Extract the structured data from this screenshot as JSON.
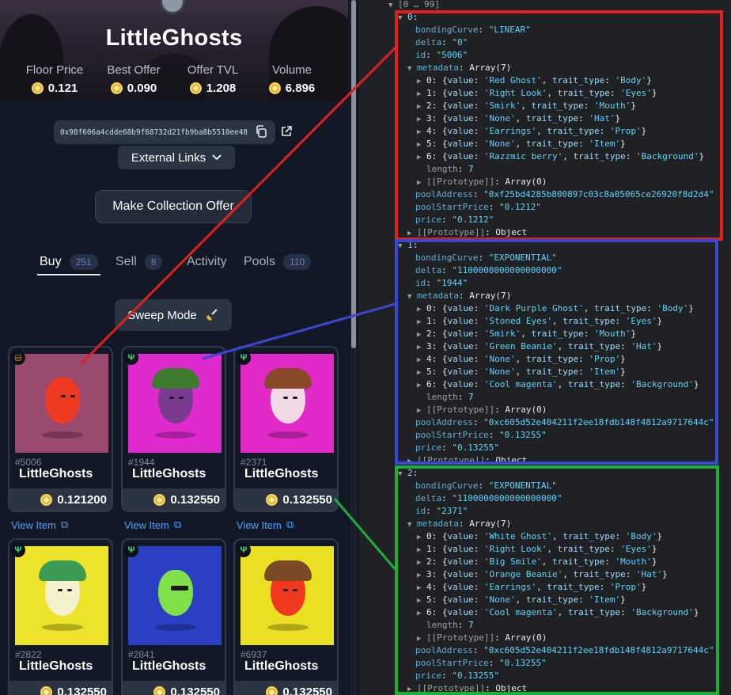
{
  "collection": {
    "title": "LittleGhosts",
    "stats": [
      {
        "label": "Floor Price",
        "value": "0.121"
      },
      {
        "label": "Best Offer",
        "value": "0.090"
      },
      {
        "label": "Offer TVL",
        "value": "1.208"
      },
      {
        "label": "Volume",
        "value": "6.896"
      }
    ],
    "address": "0x98f606a4cdde68b9f68732d21fb9ba8b5510ee48",
    "external_links": "External Links",
    "make_offer": "Make Collection Offer",
    "tabs": [
      {
        "label": "Buy",
        "count": "251"
      },
      {
        "label": "Sell",
        "count": "8"
      },
      {
        "label": "Activity",
        "count": ""
      },
      {
        "label": "Pools",
        "count": "110"
      }
    ],
    "sweep": "Sweep Mode",
    "view_item": "View Item",
    "cards": [
      {
        "id": "#5006",
        "name": "LittleGhosts",
        "price": "0.121200"
      },
      {
        "id": "#1944",
        "name": "LittleGhosts",
        "price": "0.132550"
      },
      {
        "id": "#2371",
        "name": "LittleGhosts",
        "price": "0.132550"
      },
      {
        "id": "#2822",
        "name": "LittleGhosts",
        "price": "0.132550"
      },
      {
        "id": "#2841",
        "name": "LittleGhosts",
        "price": "0.132550"
      },
      {
        "id": "#6937",
        "name": "LittleGhosts",
        "price": "0.132550"
      }
    ]
  },
  "console": {
    "header": "[0 … 99]",
    "entries": [
      {
        "index": "0",
        "bondingCurve": "\"LINEAR\"",
        "delta": "\"0\"",
        "id": "\"5006\"",
        "metadata": [
          {
            "value": "'Red Ghost'",
            "trait": "'Body'"
          },
          {
            "value": "'Right Look'",
            "trait": "'Eyes'"
          },
          {
            "value": "'Smirk'",
            "trait": "'Mouth'"
          },
          {
            "value": "'None'",
            "trait": "'Hat'"
          },
          {
            "value": "'Earrings'",
            "trait": "'Prop'"
          },
          {
            "value": "'None'",
            "trait": "'Item'"
          },
          {
            "value": "'Razzmic berry'",
            "trait": "'Background'"
          }
        ],
        "poolAddress": "\"0xf25bd4285b800897c03c8a05065ce26920f8d2d4\"",
        "poolStartPrice": "\"0.1212\"",
        "price": "\"0.1212\""
      },
      {
        "index": "1",
        "bondingCurve": "\"EXPONENTIAL\"",
        "delta": "\"1100000000000000000\"",
        "id": "\"1944\"",
        "metadata": [
          {
            "value": "'Dark Purple Ghost'",
            "trait": "'Body'"
          },
          {
            "value": "'Stoned Eyes'",
            "trait": "'Eyes'"
          },
          {
            "value": "'Smirk'",
            "trait": "'Mouth'"
          },
          {
            "value": "'Green Beanie'",
            "trait": "'Hat'"
          },
          {
            "value": "'None'",
            "trait": "'Prop'"
          },
          {
            "value": "'None'",
            "trait": "'Item'"
          },
          {
            "value": "'Cool magenta'",
            "trait": "'Background'"
          }
        ],
        "poolAddress": "\"0xc605d52e404211f2ee18fdb148f4812a9717644c\"",
        "poolStartPrice": "\"0.13255\"",
        "price": "\"0.13255\""
      },
      {
        "index": "2",
        "bondingCurve": "\"EXPONENTIAL\"",
        "delta": "\"1100000000000000000\"",
        "id": "\"2371\"",
        "metadata": [
          {
            "value": "'White Ghost'",
            "trait": "'Body'"
          },
          {
            "value": "'Right Look'",
            "trait": "'Eyes'"
          },
          {
            "value": "'Big Smile'",
            "trait": "'Mouth'"
          },
          {
            "value": "'Orange Beanie'",
            "trait": "'Hat'"
          },
          {
            "value": "'Earrings'",
            "trait": "'Prop'"
          },
          {
            "value": "'None'",
            "trait": "'Item'"
          },
          {
            "value": "'Cool magenta'",
            "trait": "'Background'"
          }
        ],
        "poolAddress": "\"0xc605d52e404211f2ee18fdb148f4812a9717644c\"",
        "poolStartPrice": "\"0.13255\"",
        "price": "\"0.13255\""
      }
    ],
    "labels": {
      "bondingCurve": "bondingCurve",
      "delta": "delta",
      "id": "id",
      "metadata": "metadata",
      "array7": "Array(7)",
      "length": "length",
      "length_val": "7",
      "prototype_arr": "[[Prototype]]",
      "array0": "Array(0)",
      "poolAddress": "poolAddress",
      "poolStartPrice": "poolStartPrice",
      "price": "price",
      "object": "Object",
      "value_key": "value",
      "trait_key": "trait_type"
    }
  },
  "highlight_colors": {
    "red": "#e0201c",
    "blue": "#3b47d0",
    "green": "#1fae38"
  }
}
